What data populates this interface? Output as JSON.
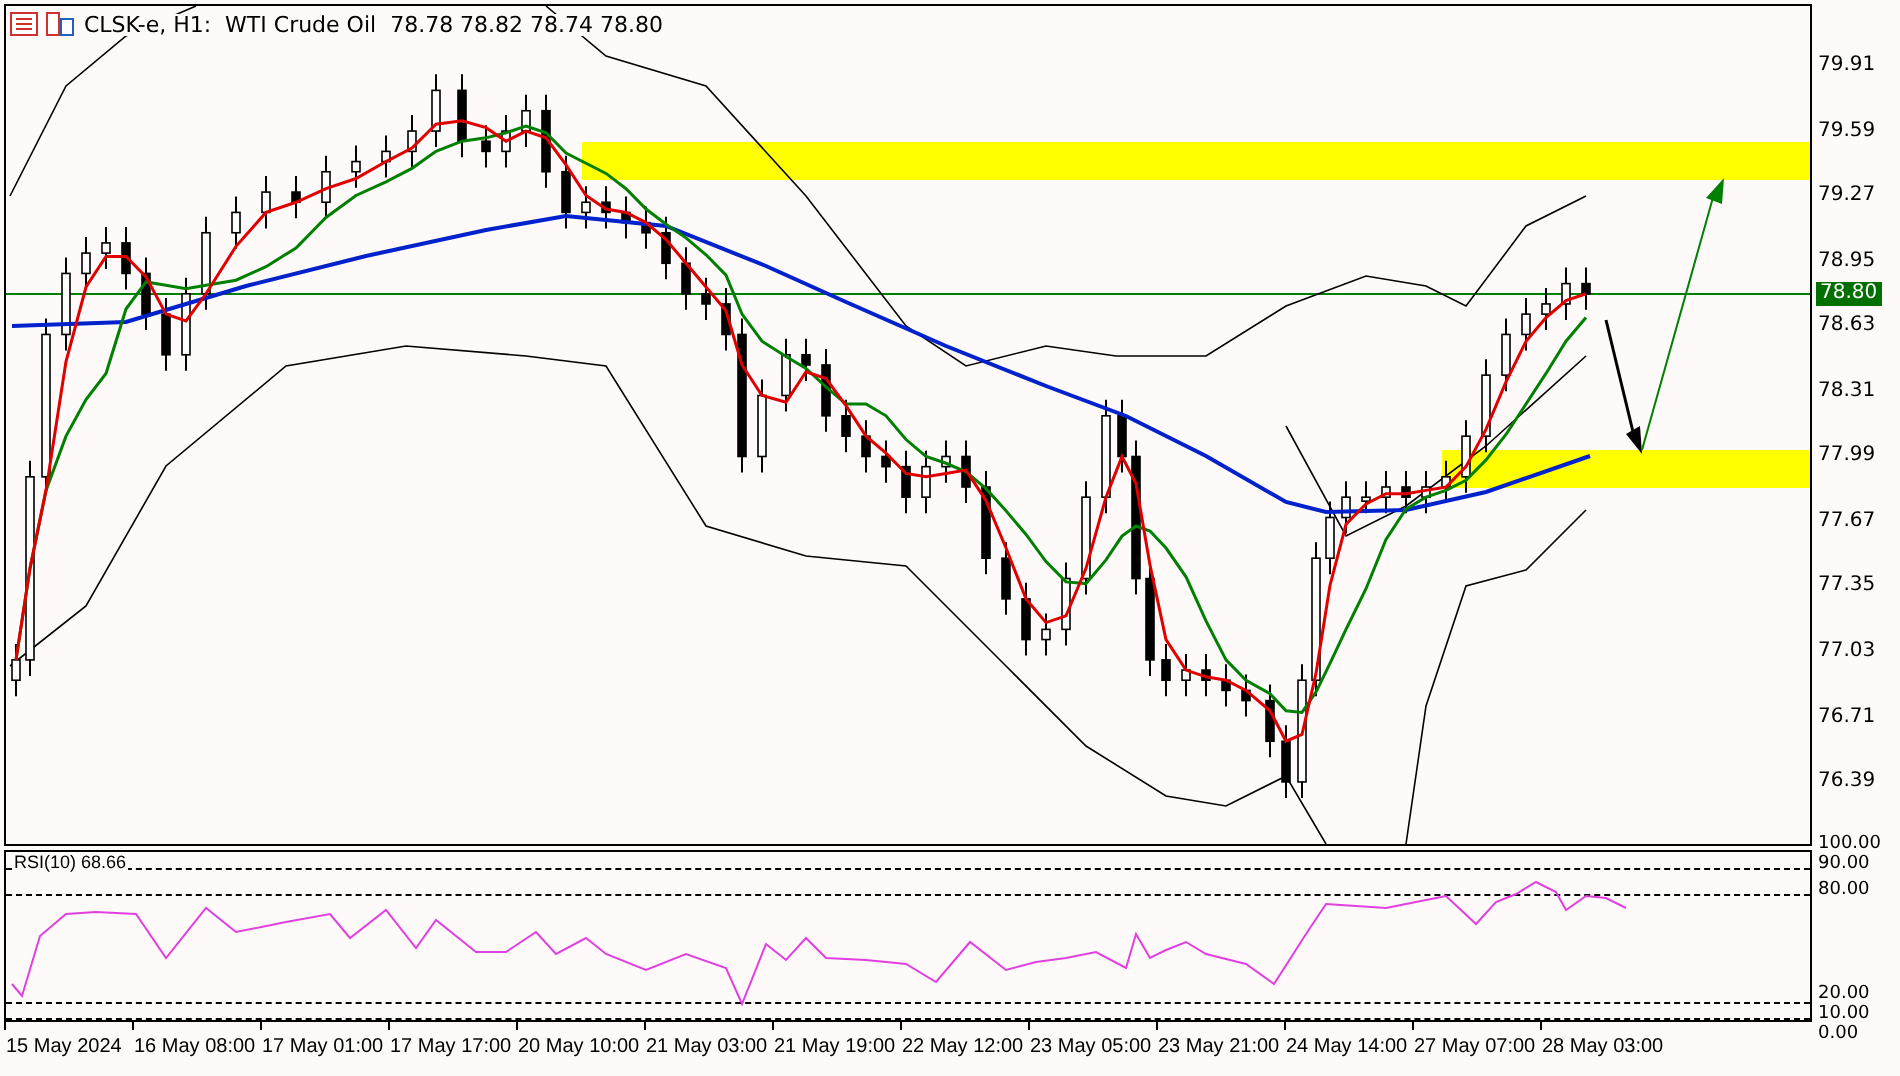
{
  "chart_header": {
    "symbol_line": "CLSK-e, H1:  WTI Crude Oil  78.78 78.82 78.74 78.80"
  },
  "price_axis": {
    "labels": [
      "79.91",
      "79.59",
      "79.27",
      "78.95",
      "78.63",
      "78.31",
      "77.99",
      "77.67",
      "77.35",
      "77.03",
      "76.71",
      "76.39"
    ],
    "current_price": "78.80"
  },
  "rsi_panel": {
    "label": "RSI(10) 68.66",
    "levels": [
      "100.00",
      "90.00",
      "80.00",
      "20.00",
      "10.00",
      "0.00"
    ]
  },
  "time_axis": {
    "labels": [
      "15 May 2024",
      "16 May 08:00",
      "17 May 01:00",
      "17 May 17:00",
      "20 May 10:00",
      "21 May 03:00",
      "21 May 19:00",
      "22 May 12:00",
      "23 May 05:00",
      "23 May 21:00",
      "24 May 14:00",
      "27 May 07:00",
      "28 May 03:00"
    ]
  }
}
